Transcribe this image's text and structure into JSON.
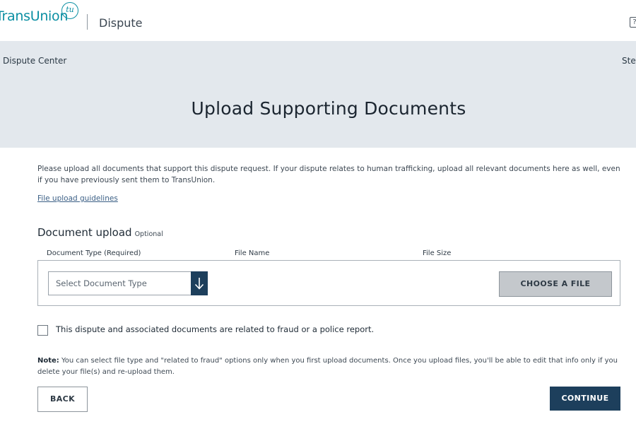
{
  "header": {
    "logo_text": "TransUnion",
    "logo_mark": "tu",
    "app_name": "Dispute",
    "help_icon": "help-icon"
  },
  "hero": {
    "breadcrumb": "Dispute Center",
    "step": "Ste",
    "title": "Upload Supporting Documents"
  },
  "intro": {
    "text": "Please upload all documents that support this dispute request. If your dispute relates to human trafficking, upload all relevant documents here as well, even if you have previously sent them to TransUnion.",
    "guidelines_link": "File upload guidelines"
  },
  "upload": {
    "section_title": "Document upload",
    "section_optional": "Optional",
    "columns": [
      "Document Type (Required)",
      "File Name",
      "File Size"
    ],
    "select_placeholder": "Select Document Type",
    "choose_button": "CHOOSE A FILE"
  },
  "fraud": {
    "checked": false,
    "label": "This dispute and associated documents are related to fraud or a police report."
  },
  "note": {
    "label": "Note:",
    "text": " You can select file type and \"related to fraud\" options only when you first upload documents. Once you upload files, you'll be able to edit that info only if you delete your file(s) and re-upload them."
  },
  "actions": {
    "back": "BACK",
    "continue": "CONTINUE"
  },
  "colors": {
    "brand": "#0b8fa3",
    "primary": "#1d3f5c",
    "hero_bg": "#e3e8ed",
    "button_gray": "#c4c8cc"
  }
}
